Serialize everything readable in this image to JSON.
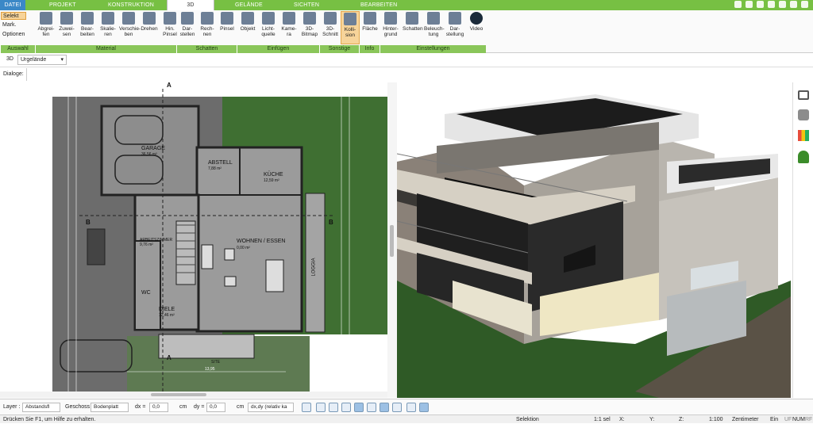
{
  "tabs": [
    "Datei",
    "Projekt",
    "Konstruktion",
    "3D",
    "Gelände",
    "Sichten",
    "Bearbeiten"
  ],
  "auswahl": {
    "select": "Selekt",
    "mark": "Mark.",
    "options": "Optionen",
    "label": "Auswahl"
  },
  "groups": {
    "material": {
      "label": "Material",
      "buttons": [
        "Abgrei-\nfen",
        "Zuwei-\nsen",
        "Bear-\nbeiten",
        "Skalie-\nren",
        "Verschie-\nben",
        "Drehen",
        "Hin.\nPinsel"
      ]
    },
    "schatten": {
      "label": "Schatten",
      "buttons": [
        "Dar-\nstellen",
        "Rech-\nnen",
        "Pinsel"
      ]
    },
    "einfuegen": {
      "label": "Einfügen",
      "buttons": [
        "Objekt",
        "Licht-\nquelle",
        "Kame-\nra",
        "3D-\nBitmap"
      ]
    },
    "sonstige": {
      "label": "Sonstige",
      "buttons": [
        "3D-\nSchnitt",
        "Kolli-\nsion"
      ]
    },
    "info": {
      "label": "Info",
      "buttons": [
        "Fläche"
      ]
    },
    "einstellungen": {
      "label": "Einstellungen",
      "buttons": [
        "Hinter-\ngrund",
        "Schatten",
        "Beleuch-\ntung",
        "Dar-\nstellung",
        "Video"
      ]
    }
  },
  "view_mode": {
    "label": "3D",
    "value": "Urgelände"
  },
  "dialoge": "Dialoge:",
  "plan_labels": {
    "garage": "GARAGE",
    "garage_area": "36,56 m²",
    "abstell": "ABSTELL",
    "abstell_area": "7,88 m²",
    "kuche": "KÜCHE",
    "kuche_area": "12,59 m²",
    "arbeit": "ARBEITSZIMMER",
    "arbeit_area": "9,76 m²",
    "wohnen": "WOHNEN / ESSEN",
    "wohnen_area": "0,00 m²",
    "loggia": "LOGGIA",
    "wc": "WC",
    "diele": "DIELE",
    "diele_area": "12,46 m²",
    "b_left": "B",
    "b_right": "B",
    "a_top": "A",
    "a_bottom": "A",
    "dim_bottom": "13,95",
    "site": "SITE"
  },
  "bottombar": {
    "layer_label": "Layer :",
    "layer_value": "Abstandsfl",
    "geschoss_label": "Geschoss :",
    "geschoss_value": "Bodenplatt",
    "dx_label": "dx =",
    "dx_value": "0,0",
    "dx_unit": "cm",
    "dy_label": "dy =",
    "dy_value": "0,0",
    "dy_unit": "cm",
    "mode_value": "dx,dy (relativ ka"
  },
  "status": {
    "help": "Drücken Sie F1, um Hilfe zu erhalten.",
    "mode": "Selektion",
    "sel": "1:1 sel",
    "x": "X:",
    "y": "Y:",
    "z": "Z:",
    "scale": "1:100",
    "unit": "Zentimeter",
    "ein": "Ein",
    "uf": "UF",
    "num": "NUM",
    "rf": "RF"
  },
  "colors": {
    "ribbon_green": "#77c043",
    "group_label_green": "#8ac65a",
    "lawn": "#3f6f32",
    "plan_floor": "#9a9a9a"
  }
}
